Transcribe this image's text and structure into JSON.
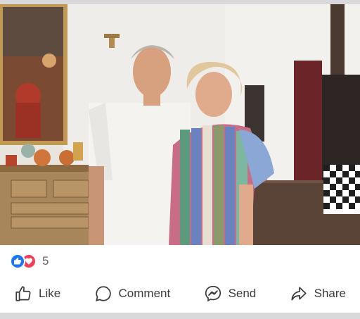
{
  "post": {
    "photo_alt": "Couple posing in a shop",
    "reactions": {
      "types": [
        "like-icon",
        "love-icon"
      ],
      "count": "5"
    },
    "actions": [
      {
        "label": "Like",
        "icon": "thumbs-up-icon"
      },
      {
        "label": "Comment",
        "icon": "comment-bubble-icon"
      },
      {
        "label": "Send",
        "icon": "messenger-icon"
      },
      {
        "label": "Share",
        "icon": "share-arrow-icon"
      }
    ]
  },
  "colors": {
    "like_blue": "#1877f2",
    "love_red": "#f33e58",
    "text_gray": "#65676b",
    "action_text": "#3a3b3c"
  }
}
